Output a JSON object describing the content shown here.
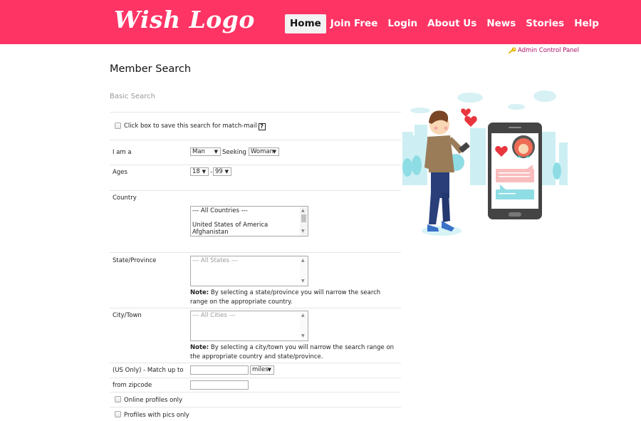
{
  "header": {
    "logo": "Wish Logo",
    "brand_color": "#fe3465",
    "nav": [
      {
        "label": "Home",
        "active": true
      },
      {
        "label": "Join Free",
        "active": false
      },
      {
        "label": "Login",
        "active": false
      },
      {
        "label": "About Us",
        "active": false
      },
      {
        "label": "News",
        "active": false
      },
      {
        "label": "Stories",
        "active": false
      },
      {
        "label": "Help",
        "active": false
      }
    ]
  },
  "admin_link": {
    "icon": "key-icon",
    "label": "Admin Control Panel"
  },
  "page": {
    "title": "Member Search",
    "subtitle": "Basic Search"
  },
  "form": {
    "save_search": {
      "label": "Click box to save this search for match-mail",
      "checked": false,
      "help_icon": "?"
    },
    "i_am": {
      "label": "I am a",
      "value": "Man",
      "seeking_label": "Seeking a",
      "seeking_value": "Woman"
    },
    "ages": {
      "label": "Ages",
      "from": "18",
      "separator": "-",
      "to": "99"
    },
    "country": {
      "label": "Country",
      "options": [
        "--- All Countries ---",
        "",
        "United States of America",
        "Afghanistan"
      ]
    },
    "state": {
      "label": "State/Province",
      "options": [
        "--- All States ---"
      ],
      "note_bold": "Note:",
      "note": " By selecting a state/province you will narrow the search range on the appropriate country."
    },
    "city": {
      "label": "City/Town",
      "options": [
        "--- All Cities ---"
      ],
      "note_bold": "Note:",
      "note": " By selecting a city/town you will narrow the search range on the appropriate country and state/province."
    },
    "distance": {
      "label": "(US Only) - Match up to",
      "value": "",
      "unit": "miles"
    },
    "zipcode": {
      "label": "from zipcode",
      "value": ""
    },
    "online_only": {
      "label": "Online profiles only",
      "checked": false
    },
    "pics_only": {
      "label": "Profiles with pics only",
      "checked": false
    }
  }
}
